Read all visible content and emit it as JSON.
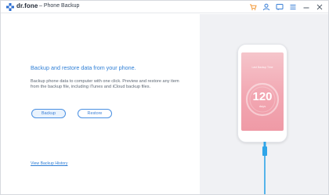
{
  "app": {
    "brand": "dr.fone",
    "module": "Phone Backup"
  },
  "toolbar_icons": [
    "cart-icon",
    "account-icon",
    "feedback-icon",
    "menu-icon",
    "minimize-icon",
    "close-icon"
  ],
  "main": {
    "headline": "Backup and restore data from your phone.",
    "description": "Backup phone data to computer with one click. Preview and restore any item from the backup file, including iTunes and iCloud backup files.",
    "backup_label": "Backup",
    "restore_label": "Restore",
    "history_link": "View Backup History"
  },
  "phone_screen": {
    "last_backup": "Last Backup Time",
    "days_value": "120",
    "days_unit": "days"
  },
  "colors": {
    "accent": "#2f7fd6",
    "logo": "#2d6fd1",
    "cart": "#f29a3a",
    "screen_pink": "#f2a7b2",
    "cable": "#2fa5e8"
  }
}
